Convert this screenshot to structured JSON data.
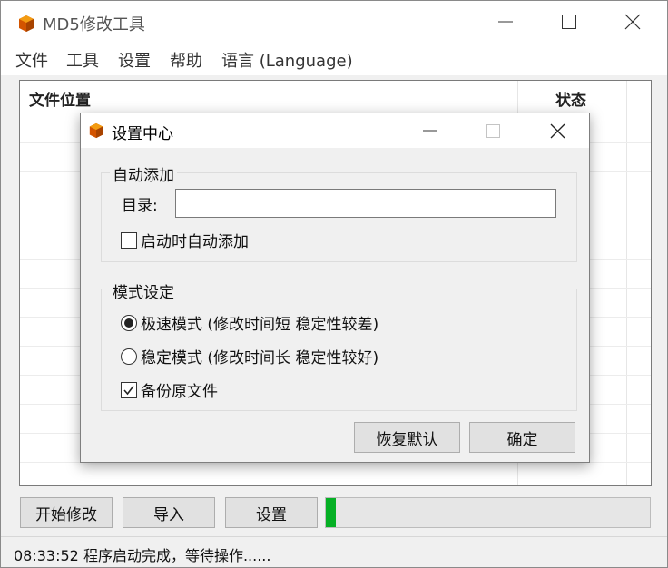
{
  "window": {
    "title": "MD5修改工具",
    "brand_color": "#c0392b"
  },
  "menu": {
    "items": [
      {
        "label": "文件"
      },
      {
        "label": "工具"
      },
      {
        "label": "设置"
      },
      {
        "label": "帮助"
      },
      {
        "label": "语言 (Language)"
      }
    ]
  },
  "list": {
    "columns": [
      "文件位置",
      "状态"
    ],
    "rows": []
  },
  "buttons": {
    "start": "开始修改",
    "import": "导入",
    "settings": "设置"
  },
  "progress": {
    "value_percent": 1,
    "color": "#06b025"
  },
  "status": {
    "text": "08:33:52 程序启动完成，等待操作......"
  },
  "dialog": {
    "title": "设置中心",
    "auto_add": {
      "group_label": "自动添加",
      "dir_label": "目录:",
      "dir_value": "",
      "startup_label": "启动时自动添加",
      "startup_checked": false
    },
    "mode": {
      "group_label": "模式设定",
      "fast_label": "极速模式 (修改时间短 稳定性较差)",
      "fast_selected": true,
      "stable_label": "稳定模式 (修改时间长 稳定性较好)",
      "stable_selected": false,
      "backup_label": "备份原文件",
      "backup_checked": true
    },
    "restore_button": "恢复默认",
    "ok_button": "确定"
  }
}
